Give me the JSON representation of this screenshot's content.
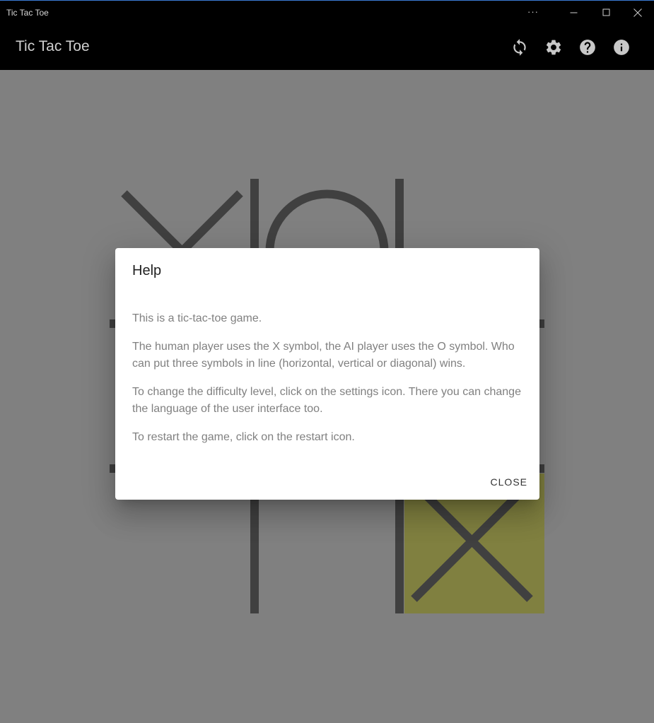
{
  "window": {
    "title": "Tic Tac Toe",
    "more_glyph": "···"
  },
  "appbar": {
    "title": "Tic Tac Toe",
    "icons": [
      "restart-icon",
      "settings-icon",
      "help-icon",
      "info-icon"
    ]
  },
  "board": {
    "cells": [
      "X",
      "O",
      "",
      "",
      "",
      "",
      "",
      "",
      "X"
    ],
    "highlight_cell": 8,
    "highlight_color": "#808000",
    "line_color": "#000000"
  },
  "dialog": {
    "title": "Help",
    "paragraphs": [
      "This is a tic-tac-toe game.",
      "The human player uses the X symbol, the AI player uses the O symbol. Who can put three symbols in line (horizontal, vertical or diagonal) wins.",
      "To change the difficulty level, click on the settings icon. There you can change the language of the user interface too.",
      "To restart the game, click on the restart icon."
    ],
    "close_label": "CLOSE"
  },
  "colors": {
    "background": "#808080",
    "bar": "#000000",
    "dialog_text": "#808080"
  }
}
